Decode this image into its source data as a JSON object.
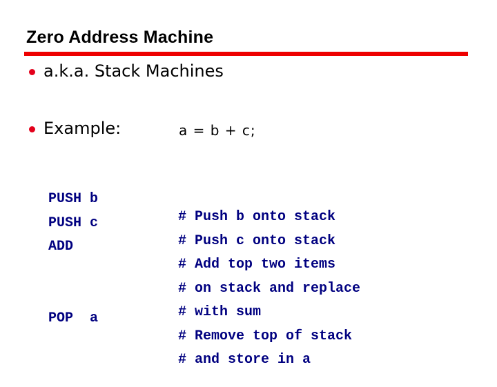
{
  "slide": {
    "title": "Zero Address Machine",
    "accent_color": "#ee0000",
    "bullets": [
      {
        "text": "a.k.a. Stack Machines"
      },
      {
        "text": "Example:"
      }
    ],
    "expression": "a = b + c;",
    "code_color": "#000080",
    "code_lines": [
      {
        "instr": "PUSH b",
        "comment": "# Push b onto stack"
      },
      {
        "instr": "PUSH c",
        "comment": "# Push c onto stack"
      },
      {
        "instr": "ADD",
        "comment": "# Add top two items"
      },
      {
        "instr": "",
        "comment": "# on stack and replace"
      },
      {
        "instr": "",
        "comment": "# with sum"
      },
      {
        "instr": "POP  a",
        "comment": "# Remove top of stack"
      },
      {
        "instr": "",
        "comment": "# and store in a"
      }
    ]
  }
}
